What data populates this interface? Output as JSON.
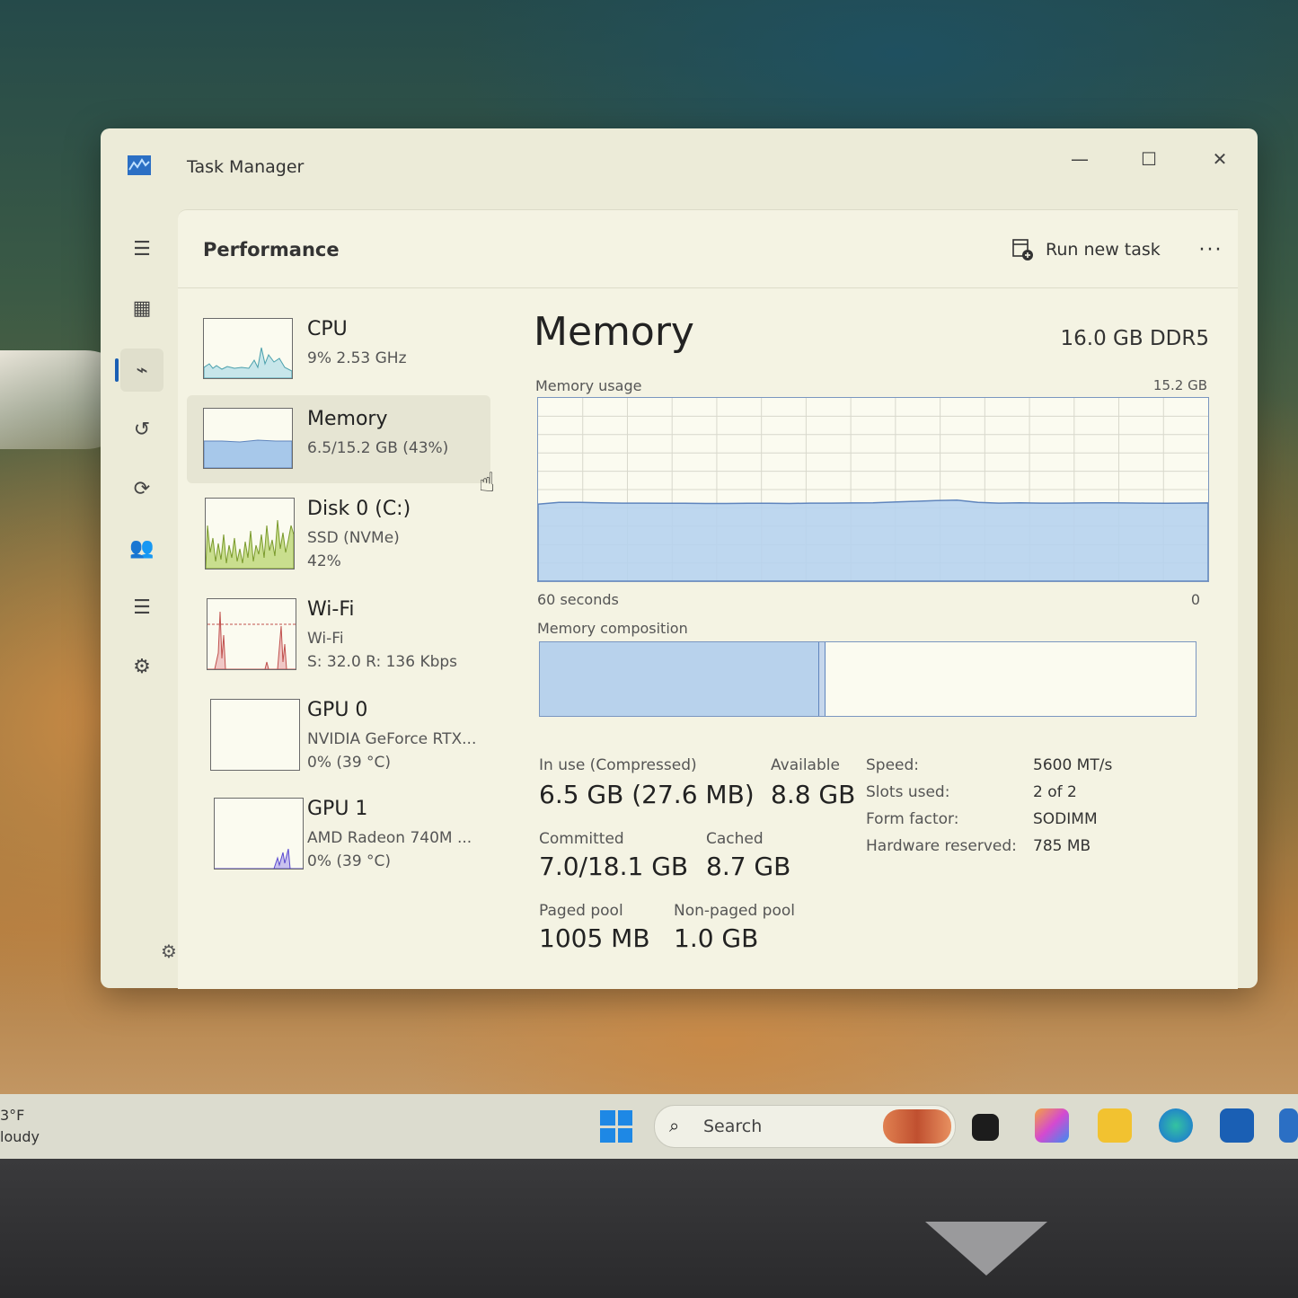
{
  "window": {
    "title": "Task Manager",
    "controls": {
      "minimize": "—",
      "maximize": "☐",
      "close": "✕"
    }
  },
  "header": {
    "page_title": "Performance",
    "run_new_task": "Run new task",
    "more": "···"
  },
  "nav": {
    "items": [
      {
        "name": "hamburger-menu-icon",
        "glyph": "☰"
      },
      {
        "name": "processes-icon",
        "glyph": "▦"
      },
      {
        "name": "performance-icon",
        "glyph": "⌁",
        "active": true
      },
      {
        "name": "app-history-icon",
        "glyph": "↺"
      },
      {
        "name": "startup-apps-icon",
        "glyph": "⟳"
      },
      {
        "name": "users-icon",
        "glyph": "👥"
      },
      {
        "name": "details-icon",
        "glyph": "☰"
      },
      {
        "name": "services-icon",
        "glyph": "⚙"
      }
    ],
    "settings_glyph": "⚙"
  },
  "perf_list": [
    {
      "name": "CPU",
      "line1": "9%  2.53 GHz",
      "line2": "",
      "line3": "",
      "color": "#7dbcc8"
    },
    {
      "name": "Memory",
      "line1": "6.5/15.2 GB (43%)",
      "line2": "",
      "line3": "",
      "color": "#9ec1e6",
      "selected": true
    },
    {
      "name": "Disk 0 (C:)",
      "line1": "SSD (NVMe)",
      "line2": "42%",
      "line3": "",
      "color": "#9fc34c"
    },
    {
      "name": "Wi-Fi",
      "line1": "Wi-Fi",
      "line2": "S: 32.0  R: 136 Kbps",
      "line3": "",
      "color": "#c0504d"
    },
    {
      "name": "GPU 0",
      "line1": "NVIDIA GeForce RTX...",
      "line2": "0%  (39 °C)",
      "line3": "",
      "color": "#7a6ad6"
    },
    {
      "name": "GPU 1",
      "line1": "AMD Radeon 740M ...",
      "line2": "0%  (39 °C)",
      "line3": "",
      "color": "#6a5ad6"
    }
  ],
  "memory": {
    "title": "Memory",
    "spec": "16.0 GB DDR5",
    "usage_label": "Memory usage",
    "usage_max": "15.2 GB",
    "axis_left": "60 seconds",
    "axis_right": "0",
    "composition_label": "Memory composition",
    "composition": {
      "in_use_fraction": 0.425,
      "modified_fraction": 0.008
    },
    "stats": {
      "in_use_label": "In use (Compressed)",
      "in_use_value": "6.5 GB (27.6 MB)",
      "available_label": "Available",
      "available_value": "8.8 GB",
      "committed_label": "Committed",
      "committed_value": "7.0/18.1 GB",
      "cached_label": "Cached",
      "cached_value": "8.7 GB",
      "paged_label": "Paged pool",
      "paged_value": "1005 MB",
      "nonpaged_label": "Non-paged pool",
      "nonpaged_value": "1.0 GB"
    },
    "specs": [
      {
        "label": "Speed:",
        "value": "5600 MT/s"
      },
      {
        "label": "Slots used:",
        "value": "2 of 2"
      },
      {
        "label": "Form factor:",
        "value": "SODIMM"
      },
      {
        "label": "Hardware reserved:",
        "value": "785 MB"
      }
    ],
    "usage_history_percent": [
      42,
      43,
      43,
      42.8,
      42.6,
      42.6,
      42.5,
      42.5,
      42.4,
      42.4,
      42.5,
      42.5,
      42.4,
      42.6,
      42.6,
      42.7,
      42.8,
      43.2,
      43.6,
      44.0,
      44.2,
      43.0,
      42.6,
      42.8,
      42.6,
      42.6,
      42.7,
      42.8,
      42.7,
      42.6,
      42.5,
      42.6,
      42.7
    ]
  },
  "taskbar": {
    "weather_temp": "3°F",
    "weather_desc": "loudy",
    "search_placeholder": "Search",
    "search_glyph": "⌕"
  }
}
